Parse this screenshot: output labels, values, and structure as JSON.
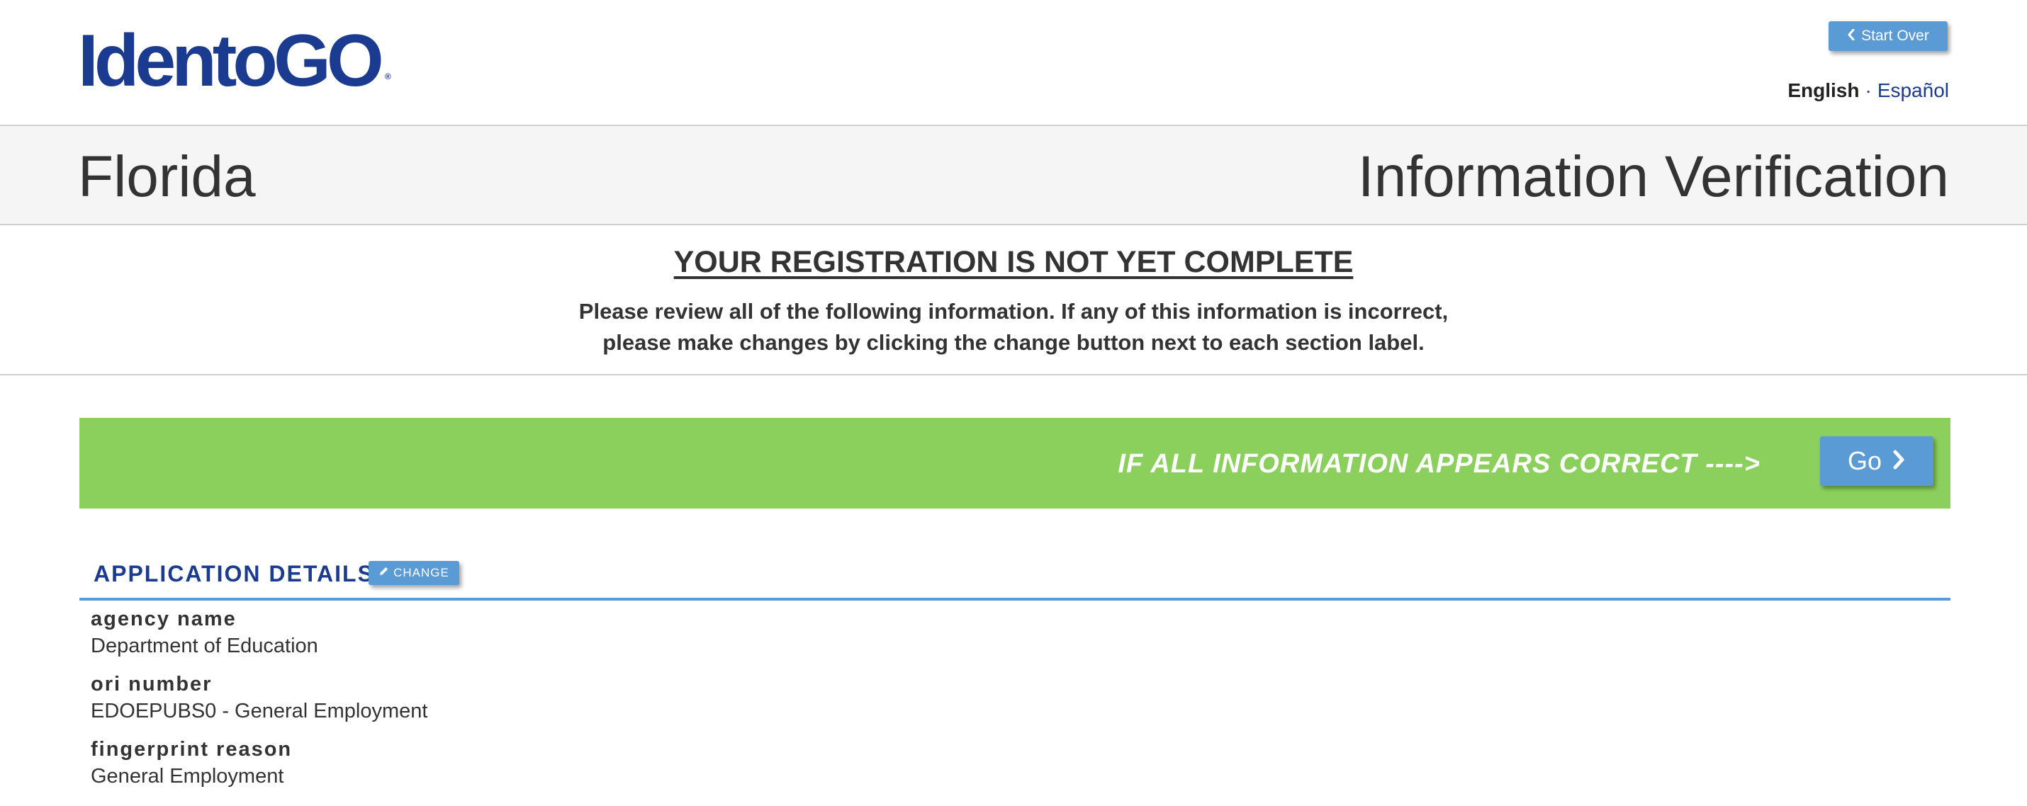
{
  "header": {
    "logo_text": "IdentoGO",
    "logo_registered_mark": "®",
    "start_over_label": "Start Over",
    "language": {
      "active": "English",
      "separator": "·",
      "alternate": "Español"
    }
  },
  "titlebar": {
    "state": "Florida",
    "page_title": "Information Verification"
  },
  "notice": {
    "heading": "YOUR REGISTRATION IS NOT YET COMPLETE",
    "line1": "Please review all of the following information. If any of this information is incorrect,",
    "line2": "please make changes by clicking the change button next to each section label."
  },
  "confirm_banner": {
    "text": "IF ALL INFORMATION APPEARS CORRECT ---->",
    "go_label": "Go",
    "background_color": "#8bd05c"
  },
  "section": {
    "title": "APPLICATION DETAILS",
    "change_label": "CHANGE",
    "fields": [
      {
        "label": "agency name",
        "value": "Department of Education"
      },
      {
        "label": "ori number",
        "value": "EDOEPUBS0 - General Employment"
      },
      {
        "label": "fingerprint reason",
        "value": "General Employment"
      }
    ]
  },
  "colors": {
    "brand_blue": "#1a3b8f",
    "button_blue": "#5b9bd5",
    "confirm_green": "#8bd05c"
  },
  "icons": {
    "start_over": "chevron-left-icon",
    "go": "chevron-right-icon",
    "change": "pencil-icon"
  }
}
